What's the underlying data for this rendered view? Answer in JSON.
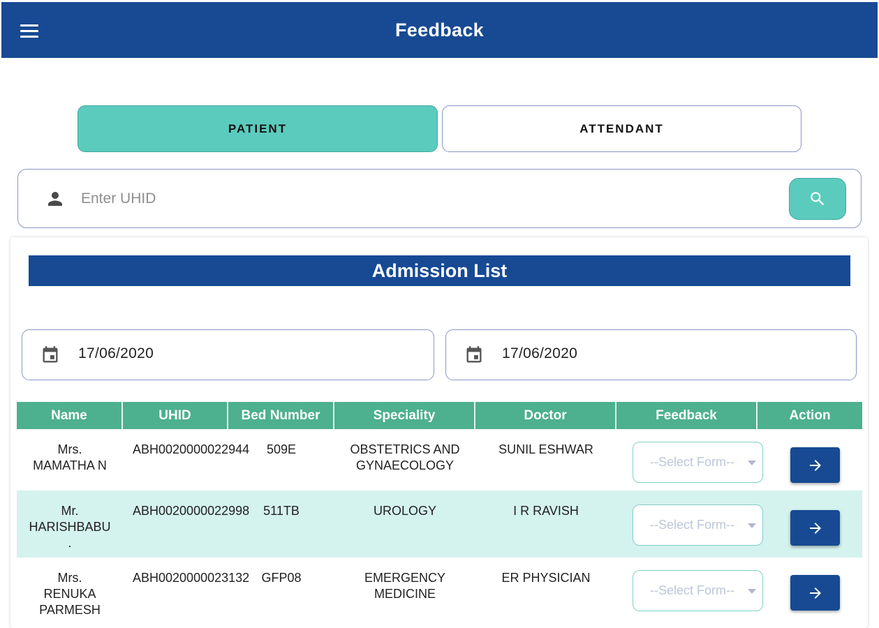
{
  "appbar": {
    "title": "Feedback"
  },
  "tabs": {
    "patient": "PATIENT",
    "attendant": "ATTENDANT"
  },
  "search": {
    "placeholder": "Enter UHID",
    "value": ""
  },
  "admission": {
    "title": "Admission List"
  },
  "dates": {
    "from": "17/06/2020",
    "to": "17/06/2020"
  },
  "table": {
    "headers": [
      "Name",
      "UHID",
      "Bed Number",
      "Speciality",
      "Doctor",
      "Feedback",
      "Action"
    ],
    "rows": [
      {
        "name": [
          "Mrs.",
          "MAMATHA N"
        ],
        "uhid": "ABH0020000022944",
        "bed": "509E",
        "speciality": [
          "OBSTETRICS AND",
          "GYNAECOLOGY"
        ],
        "doctor": "SUNIL ESHWAR",
        "feedback": "--Select Form--"
      },
      {
        "name": [
          "Mr.",
          "HARISHBABU",
          "."
        ],
        "uhid": "ABH0020000022998",
        "bed": "511TB",
        "speciality": [
          "UROLOGY"
        ],
        "doctor": "I R RAVISH",
        "feedback": "--Select Form--"
      },
      {
        "name": [
          "Mrs.",
          "RENUKA",
          "PARMESH"
        ],
        "uhid": "ABH0020000023132",
        "bed": "GFP08",
        "speciality": [
          "EMERGENCY",
          "MEDICINE"
        ],
        "doctor": "ER PHYSICIAN",
        "feedback": "--Select Form--"
      }
    ]
  },
  "colors": {
    "primary": "#174a93",
    "accent": "#5bcbbe",
    "table_header": "#4db08e",
    "row_alt": "#d4f2ee"
  },
  "icons": {
    "menu": "hamburger-icon",
    "user": "person-icon",
    "search": "search-icon",
    "calendar": "calendar-icon",
    "action": "arrow-right-icon"
  }
}
